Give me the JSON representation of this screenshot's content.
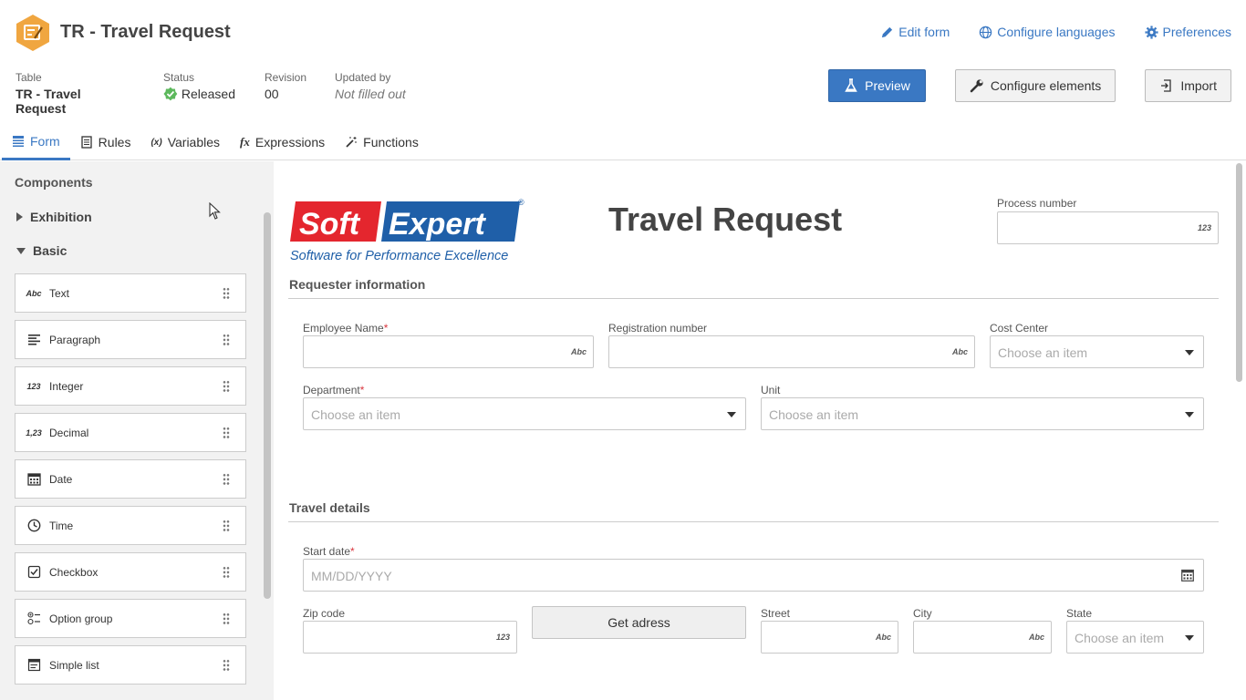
{
  "header": {
    "title": "TR - Travel Request",
    "links": {
      "edit_form": "Edit form",
      "configure_languages": "Configure languages",
      "preferences": "Preferences"
    }
  },
  "meta": {
    "table_label": "Table",
    "table_value": "TR - Travel Request",
    "status_label": "Status",
    "status_value": "Released",
    "revision_label": "Revision",
    "revision_value": "00",
    "updated_label": "Updated by",
    "updated_value": "Not filled out"
  },
  "actions": {
    "preview": "Preview",
    "configure_elements": "Configure elements",
    "import": "Import"
  },
  "tabs": [
    {
      "label": "Form",
      "icon": "form-icon",
      "active": true
    },
    {
      "label": "Rules",
      "icon": "rules-icon"
    },
    {
      "label": "Variables",
      "icon": "variables-icon"
    },
    {
      "label": "Expressions",
      "icon": "fx-icon"
    },
    {
      "label": "Functions",
      "icon": "wand-icon"
    }
  ],
  "sidebar": {
    "heading": "Components",
    "groups": {
      "exhibition": "Exhibition",
      "basic": "Basic"
    },
    "components": [
      {
        "label": "Text",
        "icon_text": "Abc"
      },
      {
        "label": "Paragraph",
        "icon": "paragraph-icon"
      },
      {
        "label": "Integer",
        "icon_text": "123"
      },
      {
        "label": "Decimal",
        "icon_text": "1,23"
      },
      {
        "label": "Date",
        "icon": "calendar-icon"
      },
      {
        "label": "Time",
        "icon": "clock-icon"
      },
      {
        "label": "Checkbox",
        "icon": "checkbox-icon"
      },
      {
        "label": "Option group",
        "icon": "option-group-icon"
      },
      {
        "label": "Simple list",
        "icon": "list-icon"
      }
    ]
  },
  "form": {
    "logo_text": {
      "soft": "Soft",
      "expert": "Expert",
      "tagline": "Software for Performance Excellence",
      "reg": "®"
    },
    "title": "Travel Request",
    "process_number_label": "Process number",
    "hints": {
      "abc": "Abc",
      "num": "123"
    },
    "placeholder_choose": "Choose an item",
    "placeholder_date": "MM/DD/YYYY",
    "required_mark": "*",
    "sections": {
      "requester": "Requester information",
      "travel": "Travel details"
    },
    "fields": {
      "employee_name": "Employee Name",
      "registration_number": "Registration number",
      "cost_center": "Cost Center",
      "department": "Department",
      "unit": "Unit",
      "start_date": "Start date",
      "zip_code": "Zip code",
      "street": "Street",
      "city": "City",
      "state": "State"
    },
    "get_address_button": "Get adress"
  },
  "colors": {
    "accent": "#3a78c3",
    "status_green": "#5cb85c",
    "logo_red": "#e4262e",
    "logo_blue": "#1f5fa8",
    "app_icon": "#f0a640"
  }
}
